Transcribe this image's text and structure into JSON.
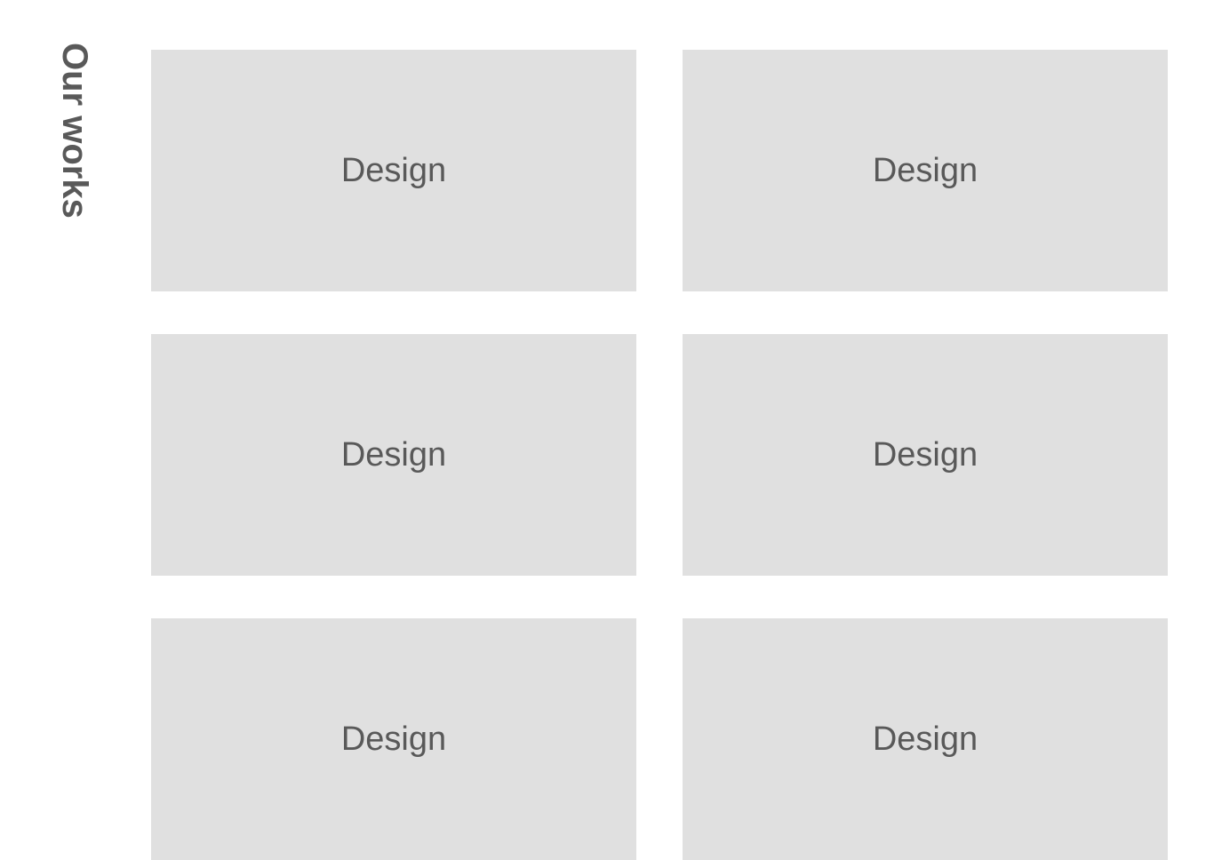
{
  "title": "Our works",
  "cards": [
    {
      "label": "Design"
    },
    {
      "label": "Design"
    },
    {
      "label": "Design"
    },
    {
      "label": "Design"
    },
    {
      "label": "Design"
    },
    {
      "label": "Design"
    }
  ]
}
